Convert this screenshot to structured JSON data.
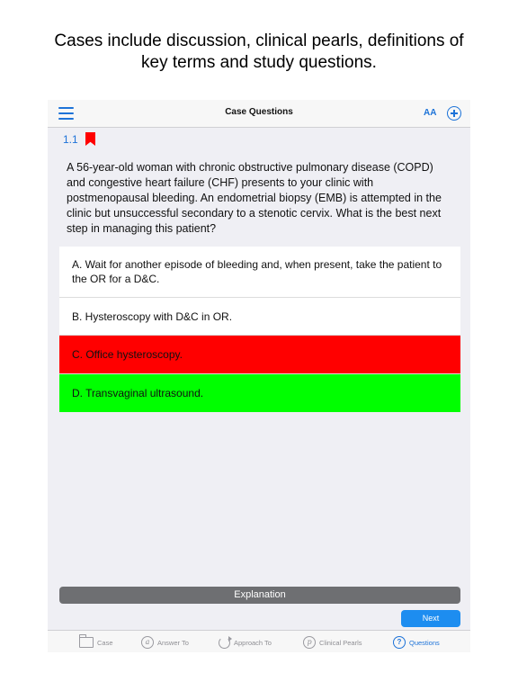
{
  "caption": {
    "line1": "Cases include discussion, clinical pearls, definitions of",
    "line2": "key terms and study questions."
  },
  "navbar": {
    "title": "Case Questions",
    "font_size_label": "AA",
    "menu_icon": "hamburger-menu-icon",
    "add_icon": "add-circle-icon"
  },
  "question": {
    "number": "1.1",
    "bookmark_color": "#ff0000",
    "text": "A 56-year-old woman with chronic obstructive pulmonary disease (COPD) and congestive heart failure (CHF) presents to your clinic with postmenopausal bleeding. An endometrial biopsy (EMB) is attempted in the clinic but unsuccessful secondary to a stenotic cervix. What is the best next step in managing this patient?"
  },
  "answers": [
    {
      "text": "A. Wait for another episode of bleeding and, when present, take the patient to the OR for a D&C.",
      "state": "default"
    },
    {
      "text": "B. Hysteroscopy with D&C in OR.",
      "state": "default"
    },
    {
      "text": "C. Office hysteroscopy.",
      "state": "incorrect",
      "color": "#ff0000"
    },
    {
      "text": "D. Transvaginal ultrasound.",
      "state": "correct",
      "color": "#00ff00"
    }
  ],
  "actions": {
    "explanation_label": "Explanation",
    "next_label": "Next"
  },
  "tabs": [
    {
      "label": "Case",
      "icon": "folder-icon"
    },
    {
      "label": "Answer To",
      "icon": "at-circle-icon",
      "glyph": "a"
    },
    {
      "label": "Approach To",
      "icon": "rotate-icon"
    },
    {
      "label": "Clinical Pearls",
      "icon": "p-circle-icon",
      "glyph": "p"
    },
    {
      "label": "Questions",
      "icon": "question-circle-icon",
      "glyph": "?",
      "active": true
    }
  ],
  "colors": {
    "accent": "#1d73d8",
    "next_button": "#1d8df0",
    "explanation_button": "#6e6f72"
  }
}
